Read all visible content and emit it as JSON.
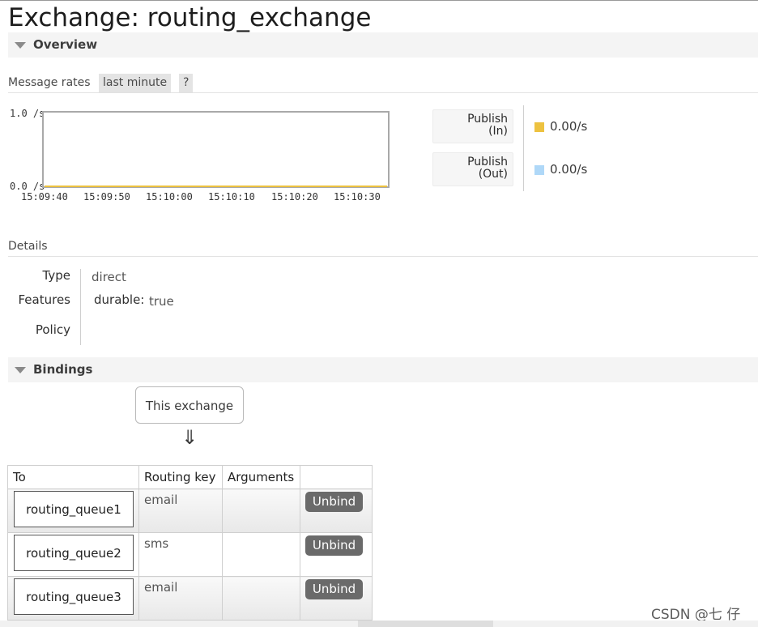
{
  "page": {
    "title": "Exchange: routing_exchange"
  },
  "overview": {
    "section_label": "Overview",
    "message_rates_label": "Message rates",
    "range_label": "last minute",
    "help_label": "?"
  },
  "chart_data": {
    "type": "line",
    "title": "",
    "xlabel": "",
    "ylabel": "",
    "x_ticks": [
      "15:09:40",
      "15:09:50",
      "15:10:00",
      "15:10:10",
      "15:10:20",
      "15:10:30"
    ],
    "y_ticks": [
      "1.0 /s",
      "0.0 /s"
    ],
    "ylim": [
      0,
      1
    ],
    "x": [
      "15:09:40",
      "15:09:50",
      "15:10:00",
      "15:10:10",
      "15:10:20",
      "15:10:30"
    ],
    "series": [
      {
        "name": "Publish (In)",
        "values": [
          0,
          0,
          0,
          0,
          0,
          0
        ],
        "color": "#edc240"
      },
      {
        "name": "Publish (Out)",
        "values": [
          0,
          0,
          0,
          0,
          0,
          0
        ],
        "color": "#afd8f8"
      }
    ]
  },
  "legend": [
    {
      "label_line1": "Publish",
      "label_line2": "(In)",
      "value": "0.00/s",
      "color": "#edc240"
    },
    {
      "label_line1": "Publish",
      "label_line2": "(Out)",
      "value": "0.00/s",
      "color": "#afd8f8"
    }
  ],
  "details": {
    "heading": "Details",
    "type_label": "Type",
    "type_value": "direct",
    "features_label": "Features",
    "feature_key": "durable:",
    "feature_value": "true",
    "policy_label": "Policy"
  },
  "bindings": {
    "section_label": "Bindings",
    "exchange_box": "This exchange",
    "arrow": "⇓",
    "columns": [
      "To",
      "Routing key",
      "Arguments",
      ""
    ],
    "rows": [
      {
        "queue": "routing_queue1",
        "routing_key": "email",
        "arguments": "",
        "action": "Unbind"
      },
      {
        "queue": "routing_queue2",
        "routing_key": "sms",
        "arguments": "",
        "action": "Unbind"
      },
      {
        "queue": "routing_queue3",
        "routing_key": "email",
        "arguments": "",
        "action": "Unbind"
      }
    ]
  },
  "watermark": "CSDN @七 仔"
}
